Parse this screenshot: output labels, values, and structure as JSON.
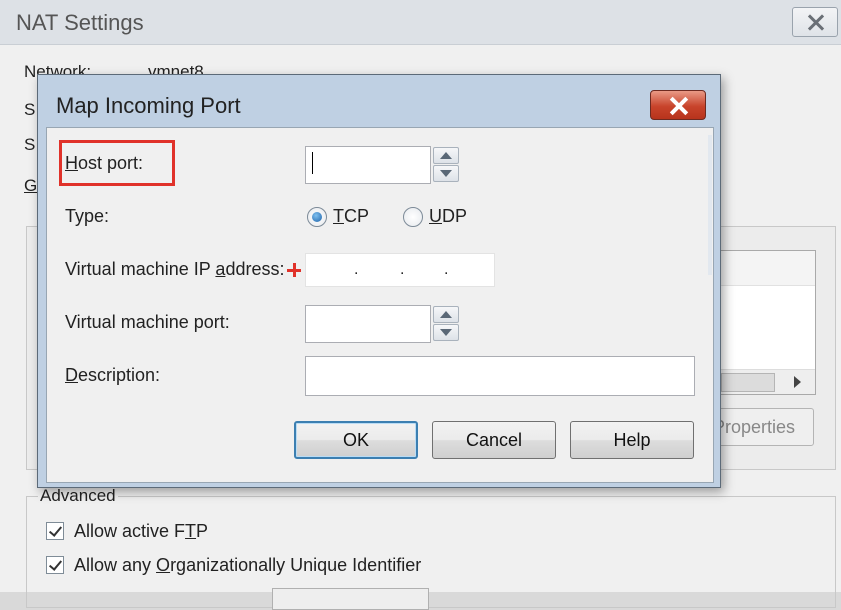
{
  "nat": {
    "title": "NAT Settings",
    "network_label": "Network:",
    "network_value": "vmnet8",
    "row2_prefix": "S",
    "row3_prefix": "S",
    "row4_prefix": "G",
    "properties_button": "Properties",
    "advanced_label": "Advanced",
    "allow_active_ftp": "Allow active FTP",
    "allow_active_ftp_checked": true,
    "allow_oui": "Allow any Organizationally Unique Identifier",
    "allow_oui_checked": true
  },
  "dialog": {
    "title": "Map Incoming Port",
    "host_port_label": "Host port:",
    "host_port_value": "",
    "type_label": "Type:",
    "type_options": [
      {
        "label": "TCP",
        "selected": true
      },
      {
        "label": "UDP",
        "selected": false
      }
    ],
    "vm_ip_label": "Virtual machine IP address:",
    "vm_ip_value": ". . .",
    "vm_port_label": "Virtual machine port:",
    "vm_port_value": "",
    "description_label": "Description:",
    "description_value": "",
    "ok_button": "OK",
    "cancel_button": "Cancel",
    "help_button": "Help"
  },
  "colors": {
    "highlight": "#e0322a",
    "close_button": "#c8442b",
    "dialog_frame": "#bfd0e3",
    "radio_selected": "#1d62a8"
  }
}
